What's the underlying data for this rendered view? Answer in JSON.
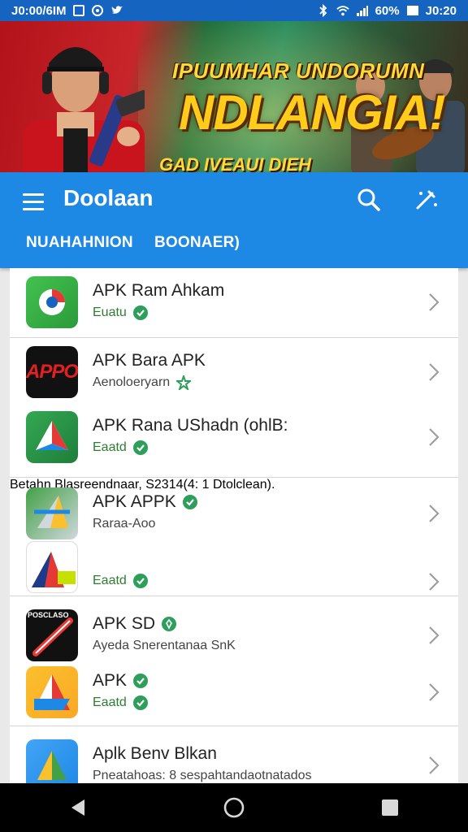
{
  "status_bar": {
    "left_text": "J0:00/6IM",
    "battery": "60%",
    "time": "J0:20"
  },
  "banner": {
    "line1": "IPUUMHAR UNDORUMN",
    "line2": "NDLANGIA!",
    "line3": "GAD IVEAUI DIEH ROBSOORIREQID"
  },
  "app_bar": {
    "title": "Doolaan",
    "tabs": [
      "NUAHAHNION",
      "BOONAER)"
    ]
  },
  "list": {
    "items": [
      {
        "name": "APK Ram Ahkam",
        "sub": "Euatu"
      },
      {
        "name": "APK Bara APK",
        "sub": "Aenoloeryarn",
        "icon_text": "APPO"
      },
      {
        "name": "APK Rana UShadn (ohlB:",
        "sub": "Eaatd"
      },
      {
        "name": "APK APPK",
        "sub": "Raraa-Aoo",
        "extra": "Betahn Blasreendnaar, S2314(4: 1 Dtolclean)."
      },
      {
        "name": "",
        "sub": "Eaatd"
      },
      {
        "name": "APK SD",
        "sub": "Ayeda Snerentanaa SnK",
        "icon_text": "POSCLASO"
      },
      {
        "name": "APK",
        "sub": "Eaatd"
      },
      {
        "name": "Aplk Benv Blkan",
        "sub": "Pneatahoas: 8 sespahtandaotnatados"
      }
    ]
  },
  "colors": {
    "status_bar": "#1565c0",
    "app_bar": "#1e88e5",
    "verified": "#2e9e5b",
    "nav_bar": "#000000"
  },
  "icons": [
    "bluetooth-icon",
    "wifi-icon",
    "signal-icon",
    "battery-icon",
    "menu-icon",
    "search-icon",
    "edit-icon",
    "verified-icon",
    "star-icon",
    "chevron-right-icon",
    "back-icon",
    "home-icon",
    "recents-icon"
  ]
}
